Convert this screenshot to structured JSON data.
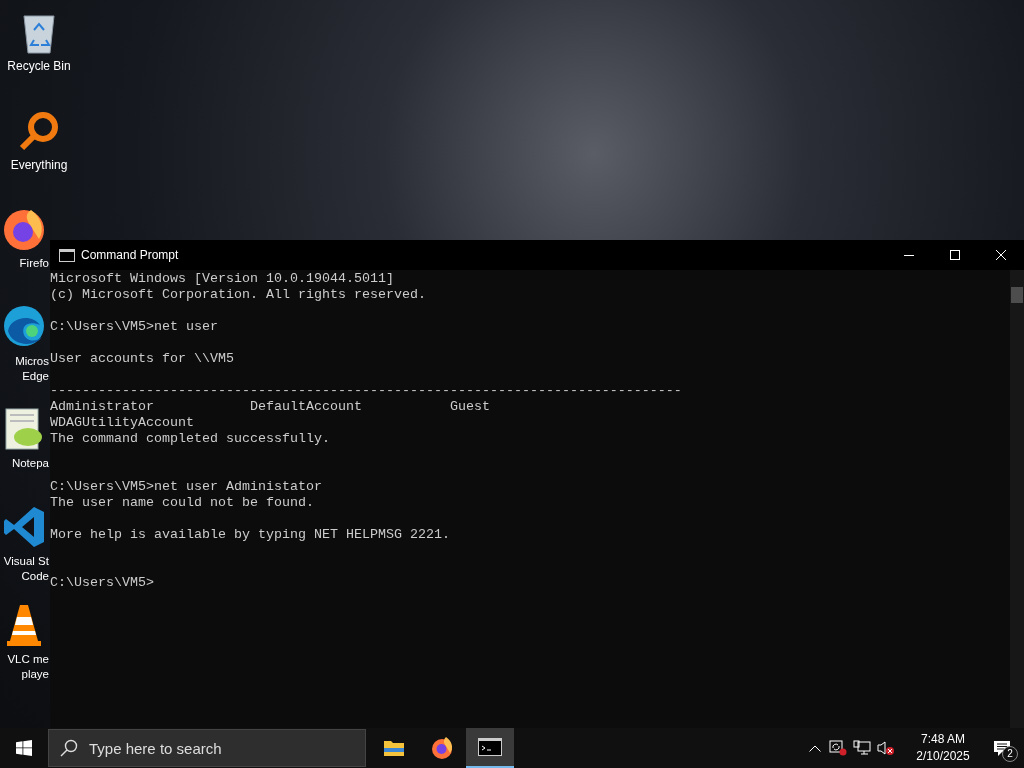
{
  "desktop_icons": [
    {
      "kind": "recycle",
      "lines": [
        "Recycle Bin"
      ]
    },
    {
      "kind": "everything",
      "lines": [
        "Everything"
      ]
    },
    {
      "kind": "firefox",
      "lines": [
        "Firefo"
      ]
    },
    {
      "kind": "edge",
      "lines": [
        "Micros",
        "Edge"
      ]
    },
    {
      "kind": "notepad",
      "lines": [
        "Notepa"
      ]
    },
    {
      "kind": "vscode",
      "lines": [
        "Visual St",
        "Code"
      ]
    },
    {
      "kind": "vlc",
      "lines": [
        "VLC me",
        "playe"
      ]
    }
  ],
  "window": {
    "title": "Command Prompt",
    "blocks": [
      {
        "kind": "tight",
        "lines": [
          "Microsoft Windows [Version 10.0.19044.5011]",
          "(c) Microsoft Corporation. All rights reserved."
        ]
      },
      {
        "kind": "spaced",
        "lines": [
          "C:\\Users\\VM5>net user"
        ]
      },
      {
        "kind": "spaced",
        "lines": [
          "User accounts for \\\\VM5"
        ]
      },
      {
        "kind": "spaced",
        "lines": [
          "-------------------------------------------------------------------------------",
          "Administrator            DefaultAccount           Guest",
          "WDAGUtilityAccount",
          "The command completed successfully."
        ]
      },
      {
        "kind": "wide",
        "lines": [
          "C:\\Users\\VM5>net user Administator",
          "The user name could not be found."
        ]
      },
      {
        "kind": "spaced",
        "lines": [
          "More help is available by typing NET HELPMSG 2221."
        ]
      },
      {
        "kind": "wide",
        "lines": [
          "C:\\Users\\VM5>"
        ]
      }
    ]
  },
  "taskbar": {
    "search": {
      "placeholder": "Type here to search"
    },
    "apps": [
      {
        "kind": "explorer",
        "selected": false
      },
      {
        "kind": "firefox",
        "selected": false
      },
      {
        "kind": "cmd",
        "selected": true
      }
    ],
    "clock": {
      "time": "7:48 AM",
      "date": "2/10/2025"
    },
    "notifications": {
      "count": "2"
    }
  }
}
